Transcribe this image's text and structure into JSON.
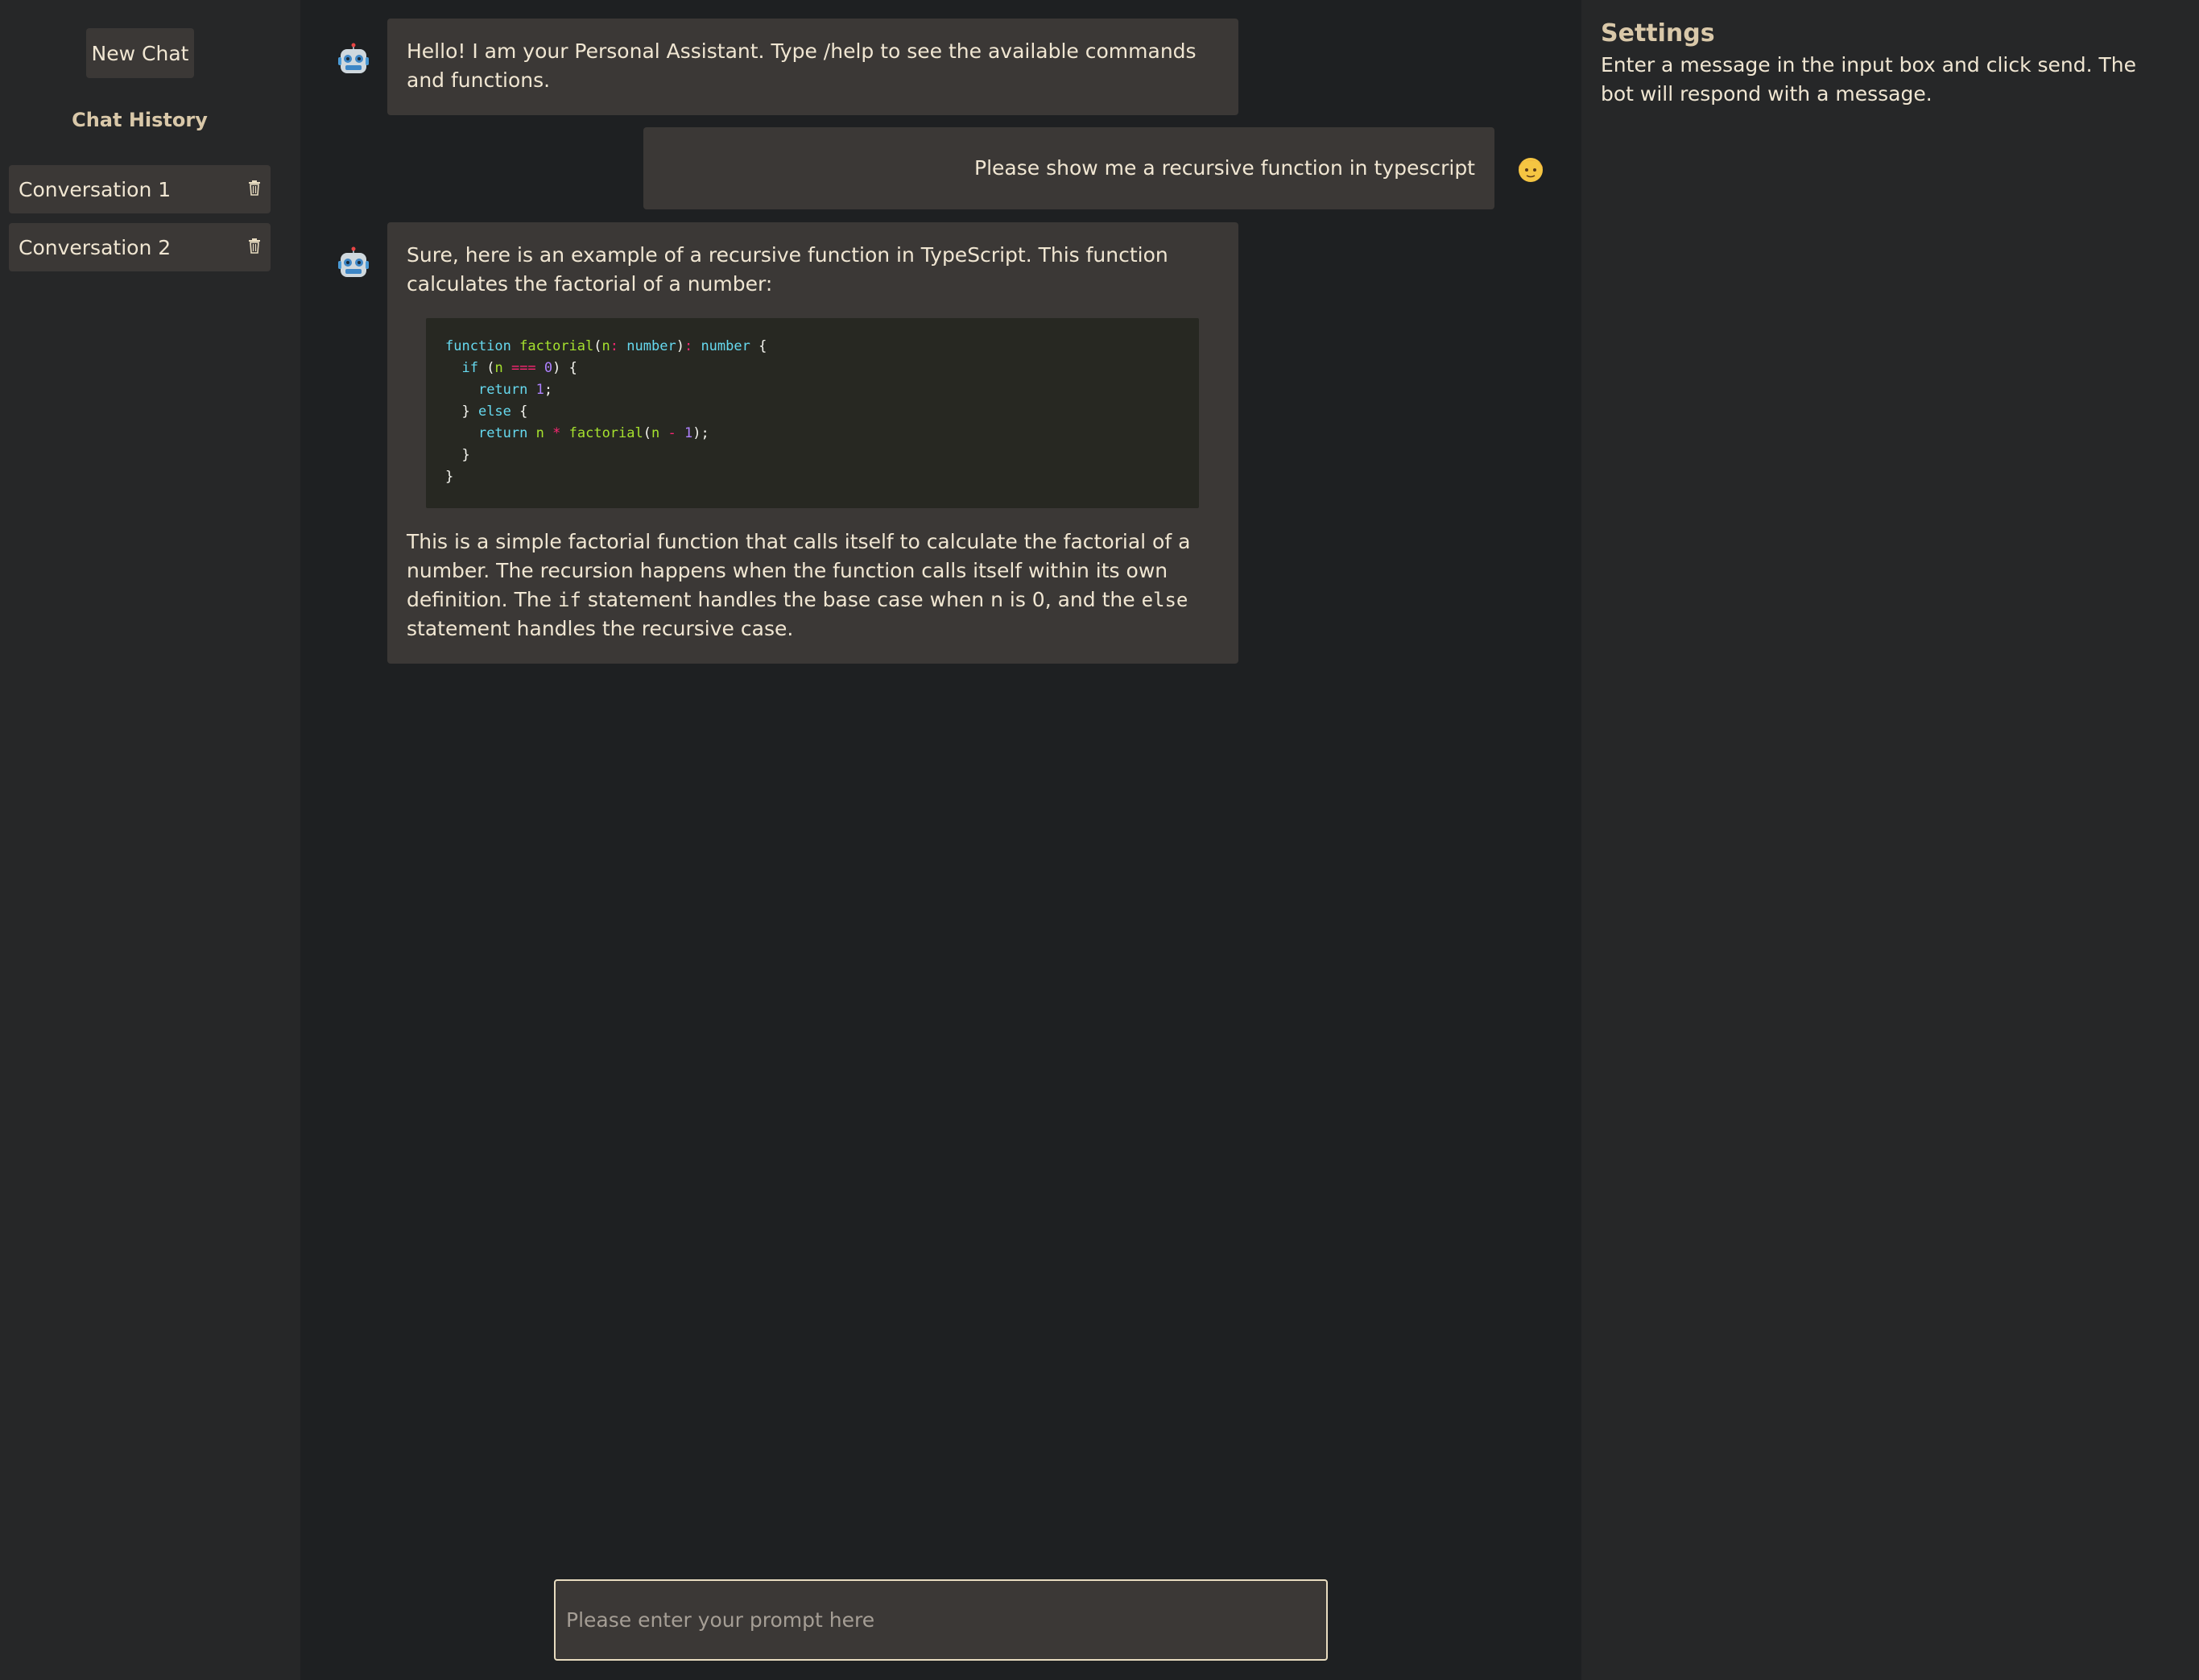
{
  "sidebar": {
    "new_chat_label": "New Chat",
    "history_title": "Chat History",
    "conversations": [
      {
        "label": "Conversation 1",
        "delete_icon": "trash-icon"
      },
      {
        "label": "Conversation 2",
        "delete_icon": "trash-icon"
      }
    ]
  },
  "chat": {
    "messages": [
      {
        "role": "bot",
        "avatar_icon": "robot-icon",
        "text": "Hello! I am your Personal Assistant. Type /help to see the available commands and functions."
      },
      {
        "role": "user",
        "avatar_icon": "user-face-icon",
        "text": "Please show me a recursive function in typescript"
      },
      {
        "role": "bot",
        "avatar_icon": "robot-icon",
        "intro": "Sure, here is an example of a recursive function in TypeScript. This function calculates the factorial of a number:",
        "code_lines": [
          "function factorial(n: number): number {",
          "  if (n === 0) {",
          "    return 1;",
          "  } else {",
          "    return n * factorial(n - 1);",
          "  }",
          "}"
        ],
        "outro_part1": "This is a simple factorial function that calls itself to calculate the factorial of a number. The recursion happens when the function calls itself within its own definition. The ",
        "outro_code1": "if",
        "outro_part2": " statement handles the base case when n is 0, and the ",
        "outro_code2": "else",
        "outro_part3": " statement handles the recursive case."
      }
    ]
  },
  "input": {
    "placeholder": "Please enter your prompt here",
    "value": ""
  },
  "settings": {
    "title": "Settings",
    "description": "Enter a message in the input box and click send. The bot will respond with a message."
  },
  "colors": {
    "background": "#1e2022",
    "panel": "#262728",
    "bubble": "#3b3836",
    "text": "#f0e6d2",
    "heading": "#d9c8a9",
    "code_bg": "#272822"
  }
}
